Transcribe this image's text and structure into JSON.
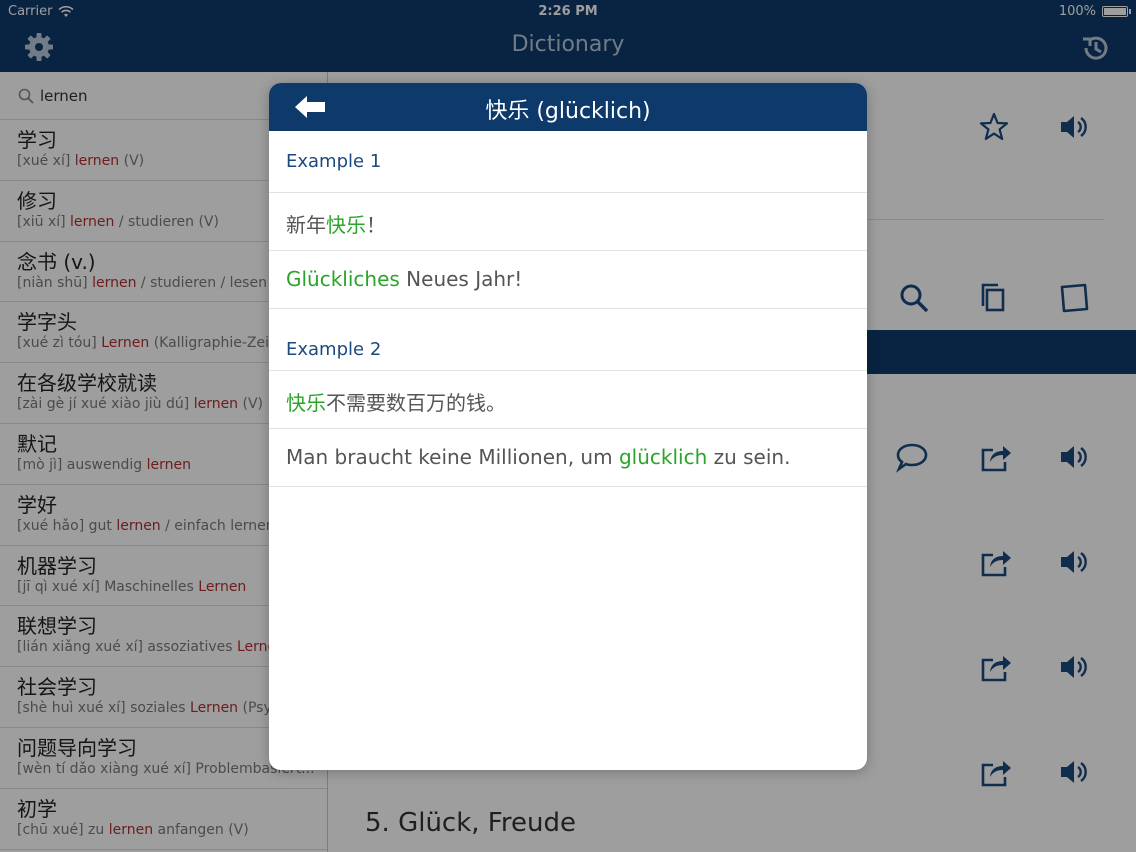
{
  "status": {
    "carrier": "Carrier",
    "time": "2:26 PM",
    "battery": "100%",
    "battery_level": 1.0
  },
  "nav": {
    "title": "Dictionary"
  },
  "search": {
    "value": "lernen",
    "placeholder": "lernen"
  },
  "words": [
    {
      "head": "学习",
      "sub_pre": "[xué xí] ",
      "sub_hl": "lernen",
      "sub_post": " (V)"
    },
    {
      "head": "修习",
      "sub_pre": "[xiū xí] ",
      "sub_hl": "lernen",
      "sub_post": " / studieren (V)"
    },
    {
      "head": "念书 (v.)",
      "sub_pre": "[niàn shū] ",
      "sub_hl": "lernen",
      "sub_post": " / studieren / lesen ("
    },
    {
      "head": "学字头",
      "sub_pre": "[xué zì tóu] ",
      "sub_hl": "Lernen",
      "sub_post": " (Kalligraphie-Zeic"
    },
    {
      "head": "在各级学校就读",
      "sub_pre": "[zài gè jí xué xiào jiù dú] ",
      "sub_hl": "lernen",
      "sub_post": " (V)"
    },
    {
      "head": "默记",
      "sub_pre": "[mò jì] auswendig ",
      "sub_hl": "lernen",
      "sub_post": ""
    },
    {
      "head": "学好",
      "sub_pre": "[xué hǎo] gut ",
      "sub_hl": "lernen",
      "sub_post": " / einfach lernen"
    },
    {
      "head": "机器学习",
      "sub_pre": "[jī qì xué xí] Maschinelles ",
      "sub_hl": "Lernen",
      "sub_post": ""
    },
    {
      "head": "联想学习",
      "sub_pre": "[lián xiǎng xué xí] assoziatives ",
      "sub_hl": "Lerne",
      "sub_post": ""
    },
    {
      "head": "社会学习",
      "sub_pre": "[shè huì xué xí] soziales ",
      "sub_hl": "Lernen",
      "sub_post": " (Psy"
    },
    {
      "head": "问题导向学习",
      "sub_pre": "[wèn tí dǎo xiàng xué xí] Problembasiert...",
      "sub_hl": "",
      "sub_post": ""
    },
    {
      "head": "初学",
      "sub_pre": "[chū xué] zu ",
      "sub_hl": "lernen",
      "sub_post": " anfangen (V)"
    }
  ],
  "main": {
    "section_title": "5. Glück, Freude"
  },
  "popover": {
    "title": "快乐 (glücklich)",
    "example1_label": "Example 1",
    "ex1_zh_pre": "新年",
    "ex1_zh_hl": "快乐",
    "ex1_zh_post": "！",
    "ex1_de_hl": "Glückliches",
    "ex1_de_post": " Neues Jahr!",
    "example2_label": "Example 2",
    "ex2_zh_hl": "快乐",
    "ex2_zh_post": "不需要数百万的钱。",
    "ex2_de_pre": "Man braucht keine Millionen, um ",
    "ex2_de_hl": "glücklich",
    "ex2_de_post": " zu sein."
  },
  "icons": [
    "settings-gear-icon",
    "history-clock-icon",
    "search-icon",
    "star-icon",
    "speaker-icon",
    "magnifier-icon",
    "copy-icon",
    "note-icon",
    "speech-bubble-icon",
    "share-icon",
    "back-arrow-icon",
    "wifi-icon",
    "battery-icon"
  ],
  "colors": {
    "nav_bg": "#0d3a6b",
    "highlight_red": "#b03030",
    "highlight_green": "#2aa52a",
    "label_blue": "#1c4a7c"
  }
}
